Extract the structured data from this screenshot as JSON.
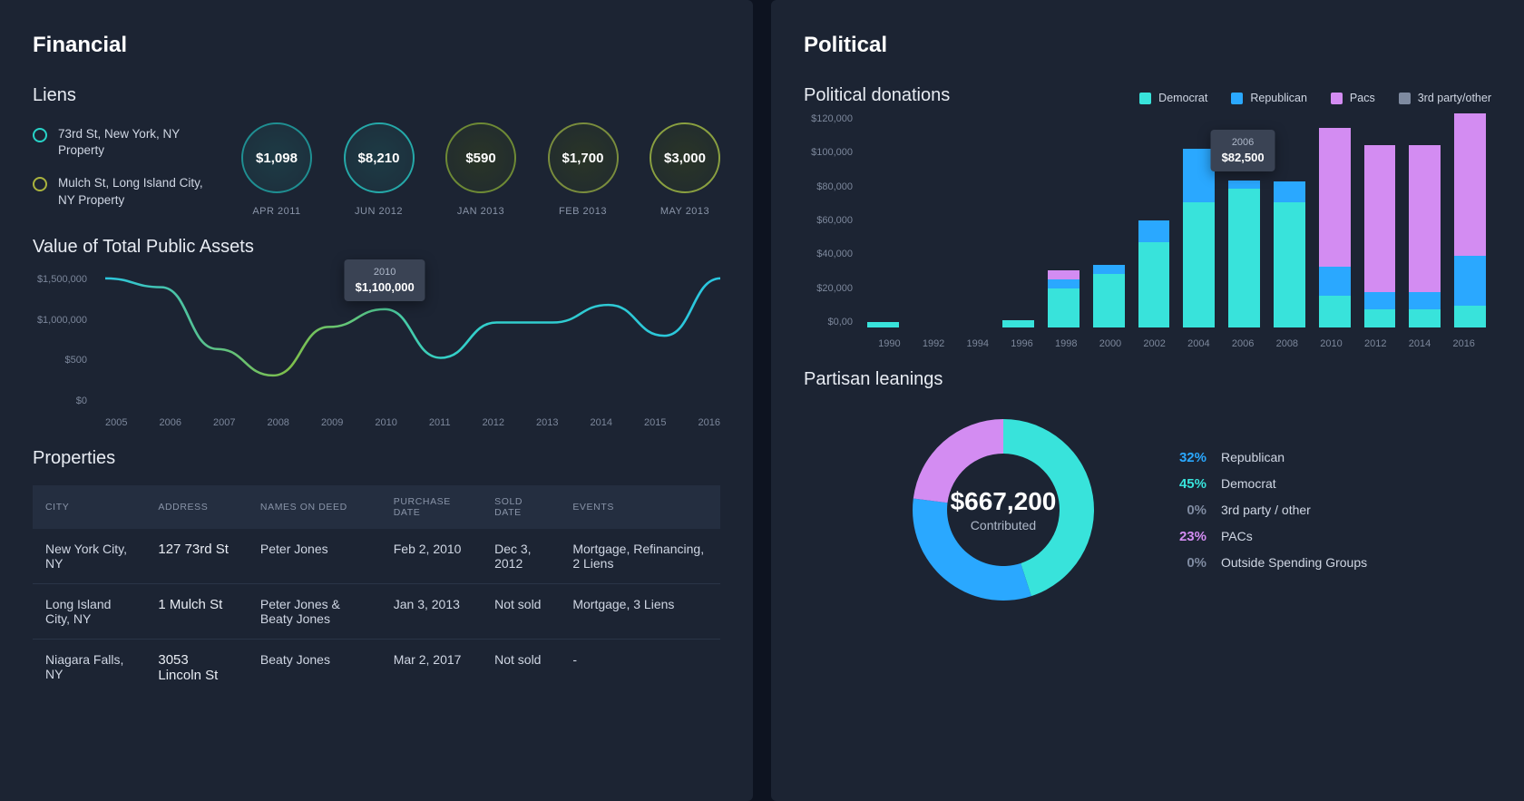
{
  "colors": {
    "democrat": "#38e3db",
    "republican": "#2aa8ff",
    "pacs": "#d38cf2",
    "other": "#7e8aa0"
  },
  "financial": {
    "title": "Financial",
    "liens": {
      "title": "Liens",
      "items": [
        {
          "label": "73rd St, New York, NY Property",
          "tone": "teal"
        },
        {
          "label": "Mulch St, Long Island City, NY Property",
          "tone": "olive"
        }
      ],
      "circles": [
        {
          "value": "$1,098",
          "date": "APR 2011"
        },
        {
          "value": "$8,210",
          "date": "JUN 2012"
        },
        {
          "value": "$590",
          "date": "JAN 2013"
        },
        {
          "value": "$1,700",
          "date": "FEB 2013"
        },
        {
          "value": "$3,000",
          "date": "MAY 2013"
        }
      ]
    },
    "assets": {
      "title": "Value of Total Public Assets",
      "tooltip": {
        "year": "2010",
        "value": "$1,100,000"
      }
    },
    "properties": {
      "title": "Properties",
      "columns": [
        "CITY",
        "ADDRESS",
        "NAMES ON DEED",
        "PURCHASE DATE",
        "SOLD DATE",
        "EVENTS"
      ],
      "rows": [
        {
          "city": "New York City, NY",
          "address": "127 73rd St",
          "names": "Peter Jones",
          "purchase": "Feb 2, 2010",
          "sold": "Dec 3, 2012",
          "events": "Mortgage, Refinancing, 2 Liens"
        },
        {
          "city": "Long Island City, NY",
          "address": "1 Mulch St",
          "names": "Peter Jones & Beaty Jones",
          "purchase": "Jan 3, 2013",
          "sold": "Not sold",
          "events": "Mortgage, 3 Liens"
        },
        {
          "city": "Niagara Falls, NY",
          "address": "3053 Lincoln St",
          "names": "Beaty Jones",
          "purchase": "Mar 2, 2017",
          "sold": "Not sold",
          "events": "-"
        }
      ]
    }
  },
  "political": {
    "title": "Political",
    "donations": {
      "title": "Political donations",
      "legend": [
        {
          "label": "Democrat",
          "colorKey": "democrat"
        },
        {
          "label": "Republican",
          "colorKey": "republican"
        },
        {
          "label": "Pacs",
          "colorKey": "pacs"
        },
        {
          "label": "3rd party/other",
          "colorKey": "other"
        }
      ],
      "tooltip": {
        "year": "2006",
        "value": "$82,500"
      }
    },
    "partisan": {
      "title": "Partisan leanings",
      "total_amount": "$667,200",
      "total_label": "Contributed",
      "breakdown": [
        {
          "pct": "32%",
          "label": "Republican",
          "colorKey": "republican"
        },
        {
          "pct": "45%",
          "label": "Democrat",
          "colorKey": "democrat"
        },
        {
          "pct": "0%",
          "label": "3rd party / other",
          "colorKey": "other"
        },
        {
          "pct": "23%",
          "label": "PACs",
          "colorKey": "pacs"
        },
        {
          "pct": "0%",
          "label": "Outside Spending Groups",
          "colorKey": "other"
        }
      ]
    }
  },
  "chart_data": [
    {
      "type": "line",
      "title": "Value of Total Public Assets",
      "xlabel": "",
      "ylabel": "",
      "ylim": [
        0,
        1500000
      ],
      "y_ticks": [
        "$1,500,000",
        "$1,000,000",
        "$500",
        "$0"
      ],
      "x": [
        2005,
        2006,
        2007,
        2008,
        2009,
        2010,
        2011,
        2012,
        2013,
        2014,
        2015,
        2016
      ],
      "values": [
        1450000,
        1350000,
        650000,
        350000,
        900000,
        1100000,
        550000,
        950000,
        950000,
        1150000,
        800000,
        1450000
      ]
    },
    {
      "type": "bar",
      "title": "Political donations",
      "xlabel": "",
      "ylabel": "",
      "ylim": [
        0,
        120000
      ],
      "y_ticks": [
        "$120,000",
        "$100,000",
        "$80,000",
        "$60,000",
        "$40,000",
        "$20,000",
        "$0,00"
      ],
      "categories": [
        1990,
        1992,
        1994,
        1996,
        1998,
        2000,
        2002,
        2004,
        2006,
        2008,
        2010,
        2012,
        2014,
        2016
      ],
      "series": [
        {
          "name": "Democrat",
          "colorKey": "democrat",
          "values": [
            3000,
            0,
            0,
            4000,
            22000,
            30000,
            48000,
            70000,
            78000,
            70000,
            18000,
            10000,
            10000,
            12000
          ]
        },
        {
          "name": "Republican",
          "colorKey": "republican",
          "values": [
            0,
            0,
            0,
            0,
            5000,
            5000,
            12000,
            30000,
            4500,
            12000,
            16000,
            10000,
            10000,
            28000
          ]
        },
        {
          "name": "Pacs",
          "colorKey": "pacs",
          "values": [
            0,
            0,
            0,
            0,
            5000,
            0,
            0,
            0,
            0,
            0,
            78000,
            82000,
            82000,
            80000
          ]
        },
        {
          "name": "3rd party/other",
          "colorKey": "other",
          "values": [
            0,
            0,
            0,
            0,
            0,
            0,
            0,
            0,
            0,
            0,
            0,
            0,
            0,
            0
          ]
        }
      ]
    },
    {
      "type": "pie",
      "title": "Partisan leanings",
      "slices": [
        {
          "label": "Democrat",
          "pct": 45,
          "colorKey": "democrat"
        },
        {
          "label": "Republican",
          "pct": 32,
          "colorKey": "republican"
        },
        {
          "label": "PACs",
          "pct": 23,
          "colorKey": "pacs"
        },
        {
          "label": "3rd party / other",
          "pct": 0,
          "colorKey": "other"
        },
        {
          "label": "Outside Spending Groups",
          "pct": 0,
          "colorKey": "other"
        }
      ],
      "center_value": "$667,200",
      "center_label": "Contributed"
    }
  ]
}
